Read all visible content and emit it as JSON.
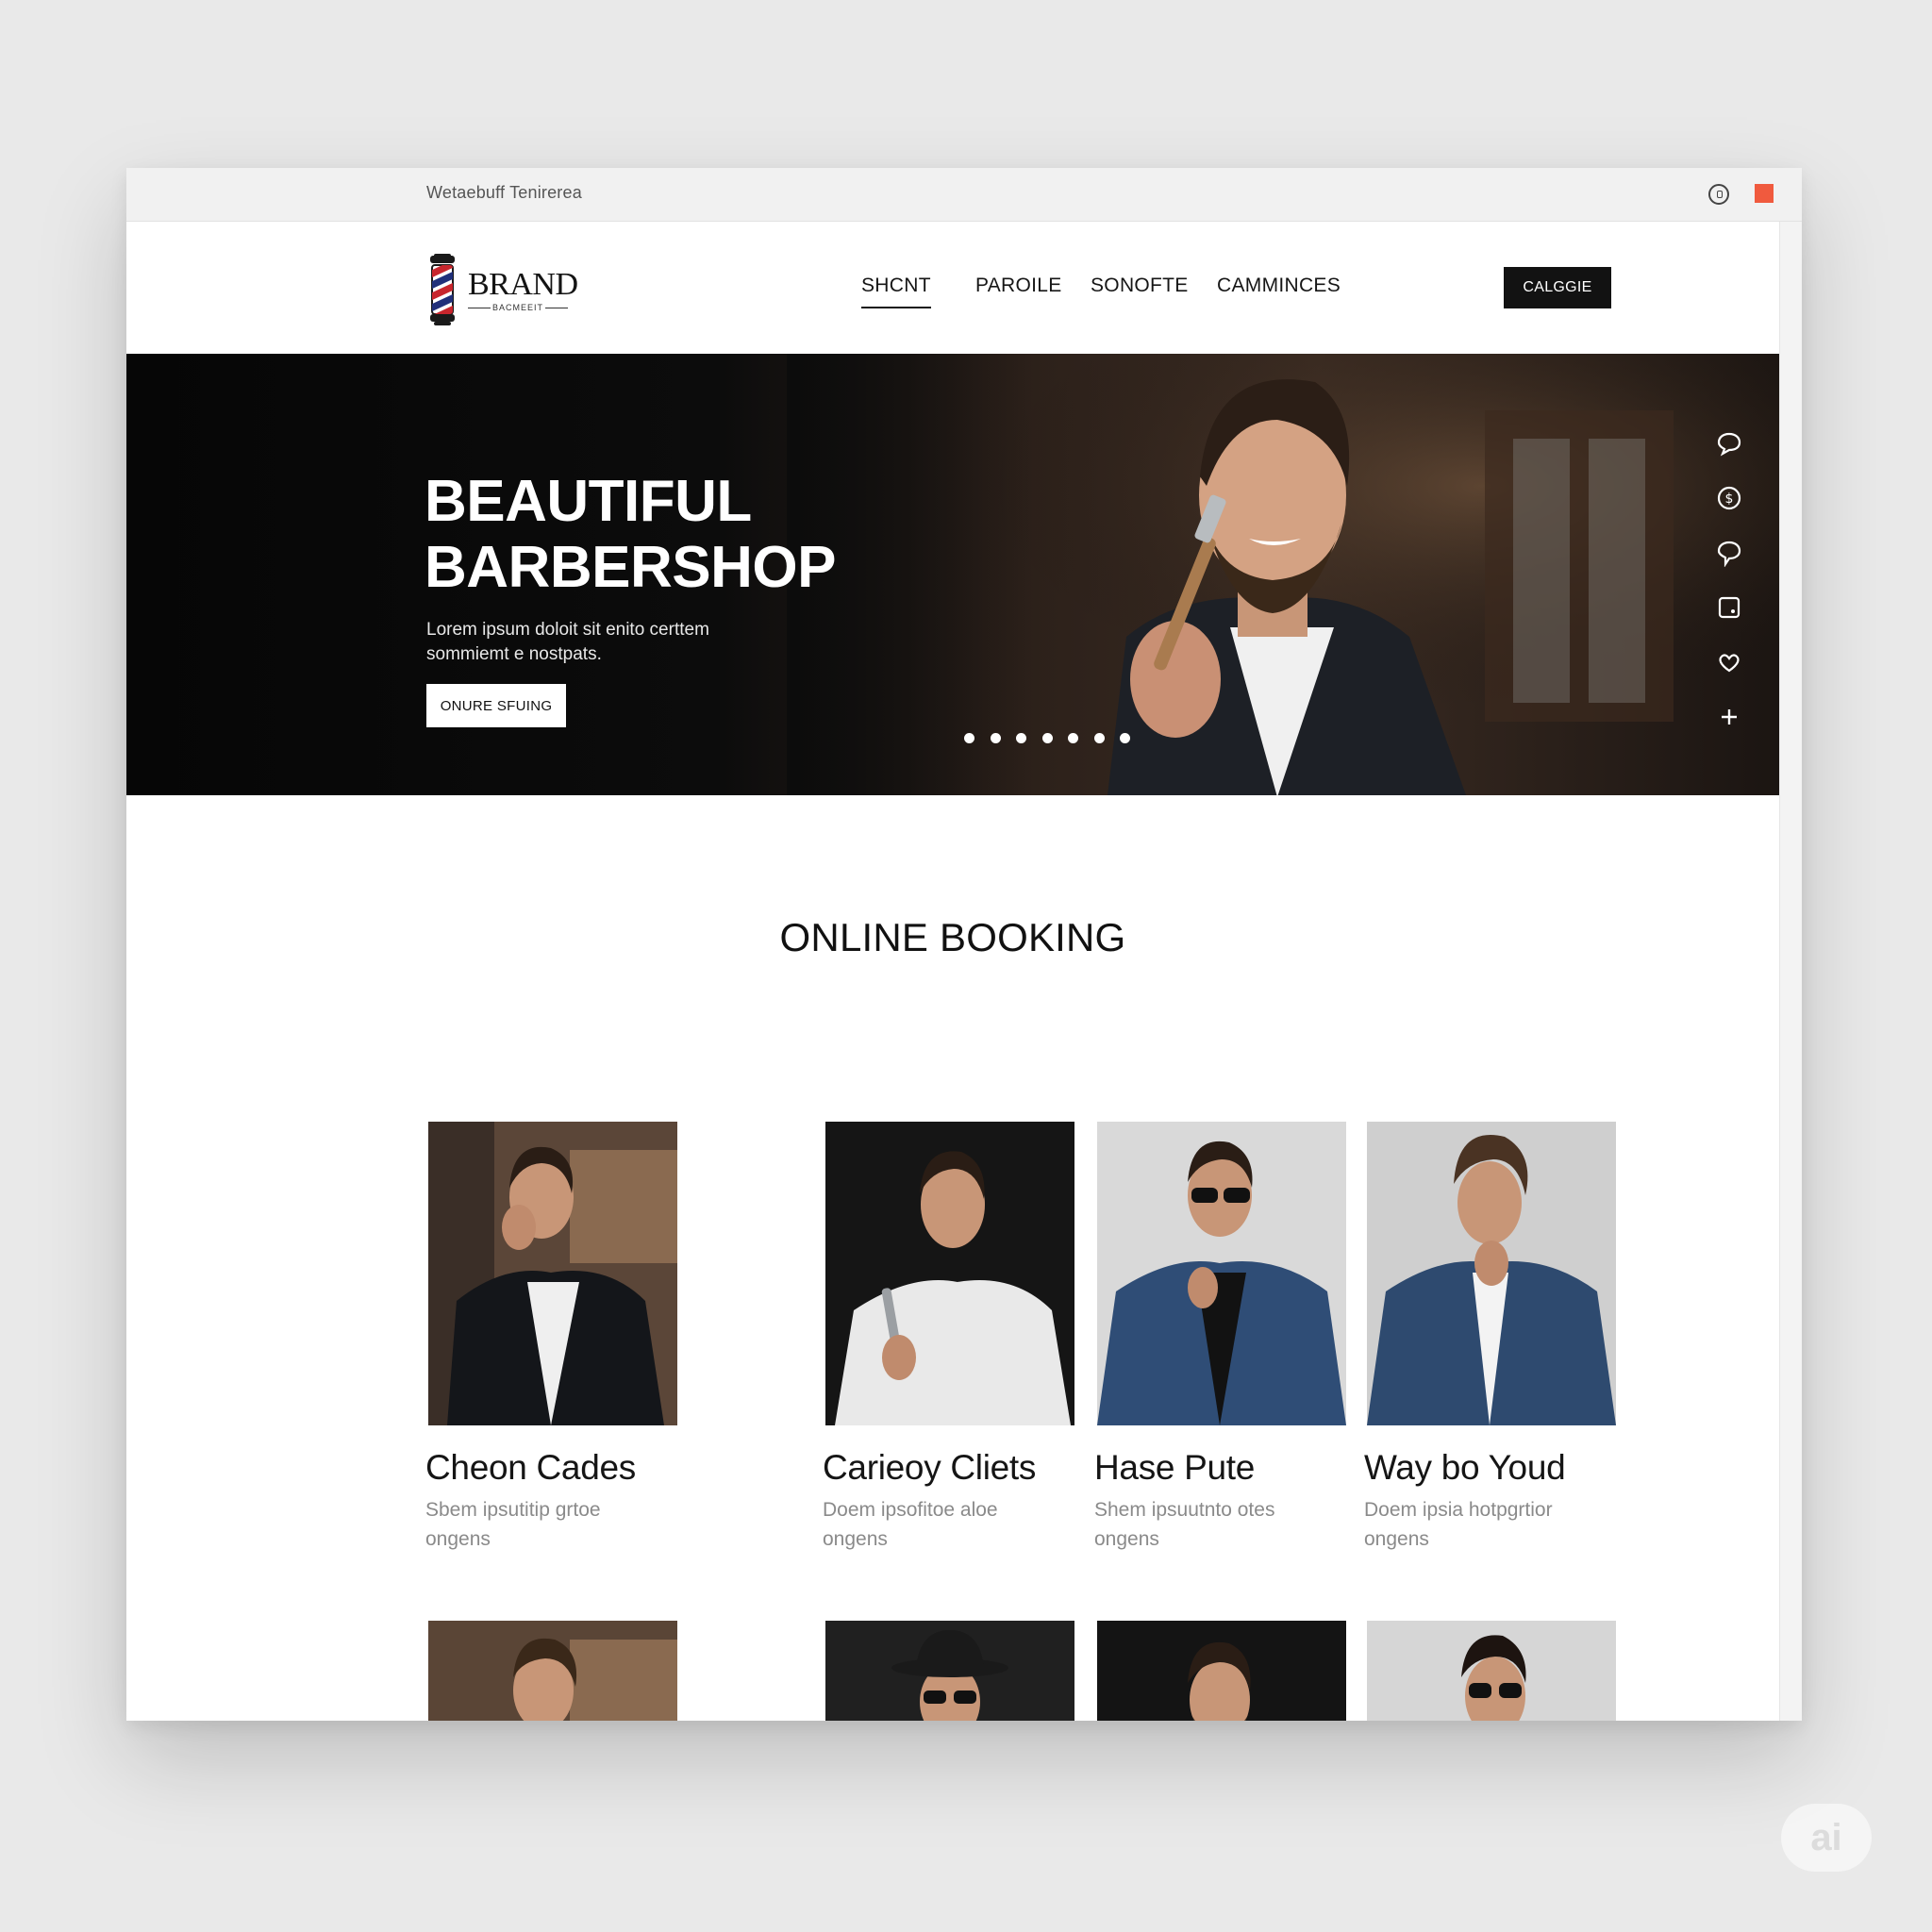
{
  "window": {
    "title": "Wetaebuff Tenirerea"
  },
  "colors": {
    "accent": "#121212",
    "close": "#f05a3e",
    "muted_text": "#8a8a8a",
    "hero_bg": "#0c0c0c"
  },
  "brand": {
    "name": "BRAND",
    "sub": "BACMEEIT"
  },
  "nav": {
    "items": [
      {
        "label": "SHCNT",
        "active": true
      },
      {
        "label": "PAROILE",
        "active": false
      },
      {
        "label": "SONOFTE",
        "active": false
      },
      {
        "label": "CAMMINCES",
        "active": false
      }
    ],
    "cta": "CALGGIE"
  },
  "hero": {
    "title_line1": "BEAUTIFUL",
    "title_line2": "BARBERSHOP",
    "desc_line1": "Lorem ipsum doloit sit enito certtem",
    "desc_line2": "sommiemt e nostpats.",
    "button": "ONURE SFUING",
    "slide_count": 7,
    "active_slide": 6
  },
  "side_icons": [
    "chat-bubble-icon",
    "dollar-coin-icon",
    "speech-icon",
    "square-icon",
    "heart-hand-icon",
    "plus-icon"
  ],
  "booking": {
    "title": "ONLINE BOOKING",
    "cards": [
      {
        "name": "Cheon Cades",
        "desc_line1": "Sbem ipsutitip grtoe",
        "desc_line2": "ongens"
      },
      {
        "name": "Carieoy Cliets",
        "desc_line1": "Doem ipsofitoe aloe",
        "desc_line2": "ongens"
      },
      {
        "name": "Hase Pute",
        "desc_line1": "Shem ipsuutnto otes",
        "desc_line2": "ongens"
      },
      {
        "name": "Way bo Youd",
        "desc_line1": "Doem ipsia hotpgrtior",
        "desc_line2": "ongens"
      }
    ]
  },
  "watermark": "ai"
}
